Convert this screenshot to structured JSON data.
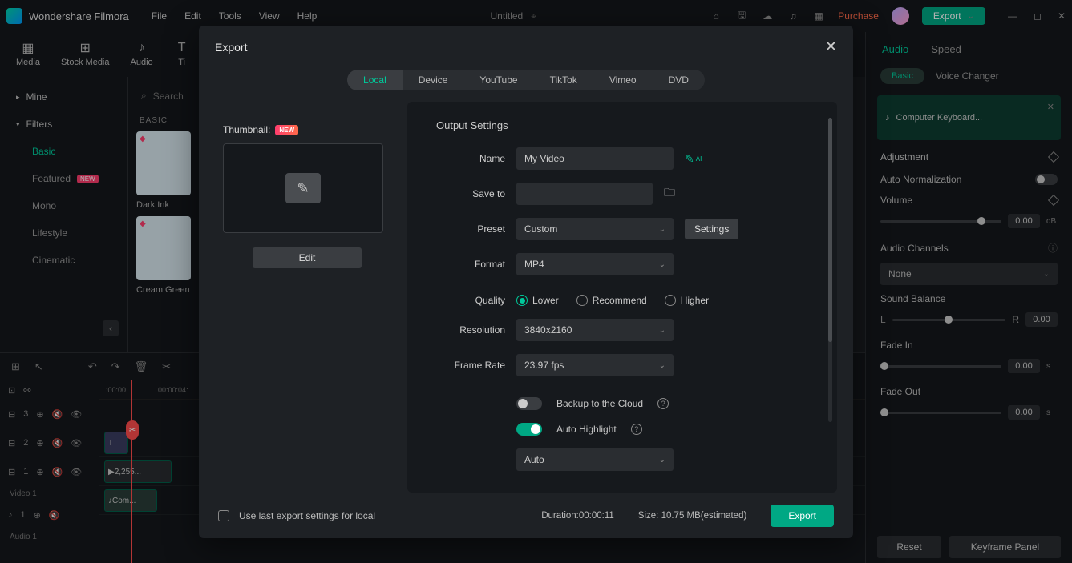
{
  "app": {
    "name": "Wondershare Filmora",
    "docTitle": "Untitled"
  },
  "menubar": [
    "File",
    "Edit",
    "Tools",
    "View",
    "Help"
  ],
  "titleActions": {
    "purchase": "Purchase",
    "export": "Export"
  },
  "toolbar": [
    {
      "id": "media",
      "label": "Media",
      "icon": "▦"
    },
    {
      "id": "stock",
      "label": "Stock Media",
      "icon": "⊞"
    },
    {
      "id": "audio",
      "label": "Audio",
      "icon": "♪"
    },
    {
      "id": "titles",
      "label": "Ti",
      "icon": "T"
    }
  ],
  "sidebar": {
    "mine": "Mine",
    "filters": "Filters",
    "items": [
      {
        "label": "Basic",
        "active": true
      },
      {
        "label": "Featured",
        "new": true
      },
      {
        "label": "Mono"
      },
      {
        "label": "Lifestyle"
      },
      {
        "label": "Cinematic"
      }
    ]
  },
  "browser": {
    "searchPlaceholder": "Search",
    "section": "BASIC",
    "thumbs": [
      {
        "label": "Dark Ink"
      },
      {
        "label": "Cream Green"
      }
    ]
  },
  "modal": {
    "title": "Export",
    "tabs": [
      "Local",
      "Device",
      "YouTube",
      "TikTok",
      "Vimeo",
      "DVD"
    ],
    "activeTab": "Local",
    "thumbnailLabel": "Thumbnail:",
    "newBadge": "NEW",
    "editBtn": "Edit",
    "outputTitle": "Output Settings",
    "fields": {
      "nameLabel": "Name",
      "nameValue": "My Video",
      "saveLabel": "Save to",
      "saveValue": "",
      "presetLabel": "Preset",
      "presetValue": "Custom",
      "settingsBtn": "Settings",
      "formatLabel": "Format",
      "formatValue": "MP4",
      "qualityLabel": "Quality",
      "qualityOpts": {
        "lower": "Lower",
        "recommend": "Recommend",
        "higher": "Higher"
      },
      "resolutionLabel": "Resolution",
      "resolutionValue": "3840x2160",
      "frameRateLabel": "Frame Rate",
      "frameRateValue": "23.97 fps",
      "backupLabel": "Backup to the Cloud",
      "highlightLabel": "Auto Highlight",
      "autoValue": "Auto"
    },
    "footer": {
      "useLastLabel": "Use last export settings for local",
      "durationLabel": "Duration:",
      "durationValue": "00:00:11",
      "sizeLabel": "Size: ",
      "sizeValue": "10.75 MB(estimated)",
      "exportBtn": "Export"
    }
  },
  "rightPanel": {
    "tabs": {
      "audio": "Audio",
      "speed": "Speed"
    },
    "subtabs": {
      "basic": "Basic",
      "voice": "Voice Changer"
    },
    "clipName": "Computer Keyboard...",
    "adjustment": "Adjustment",
    "autoNorm": "Auto Normalization",
    "volume": "Volume",
    "volumeVal": "0.00",
    "volumeUnit": "dB",
    "audioChannels": "Audio Channels",
    "audioChannelsVal": "None",
    "soundBalance": "Sound Balance",
    "sbL": "L",
    "sbR": "R",
    "sbVal": "0.00",
    "fadeIn": "Fade In",
    "fadeInVal": "0.00",
    "fadeInUnit": "s",
    "fadeOut": "Fade Out",
    "fadeOutVal": "0.00",
    "fadeOutUnit": "s",
    "reset": "Reset",
    "keyframe": "Keyframe Panel"
  },
  "timeline": {
    "ruler": [
      ":00:00",
      "00:00:04:"
    ],
    "tracks": [
      {
        "head": "3",
        "label": ""
      },
      {
        "head": "2",
        "label": ""
      },
      {
        "head": "1",
        "label": "",
        "name": "Video 1"
      },
      {
        "head": "1",
        "label": "",
        "name": "Audio 1"
      }
    ],
    "clip1": "2,255...",
    "clip2": "Com..."
  }
}
